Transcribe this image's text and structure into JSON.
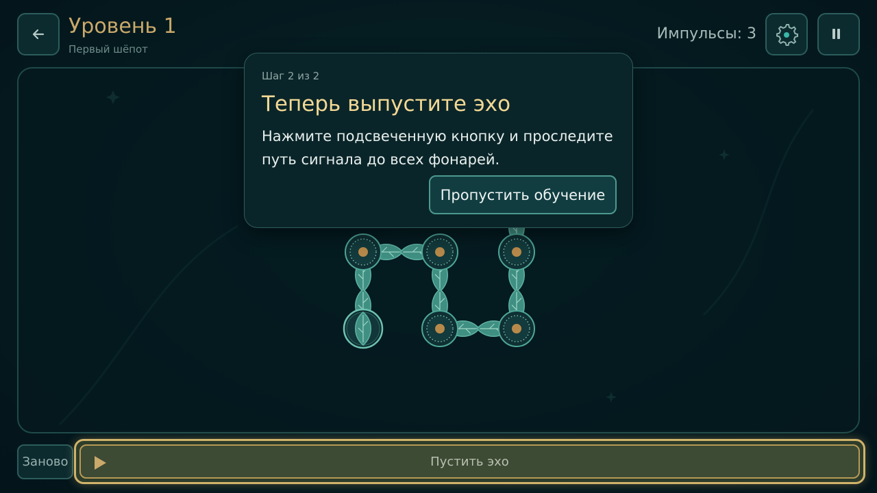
{
  "header": {
    "back_icon": "arrow-left-icon",
    "level_title": "Уровень 1",
    "level_subtitle": "Первый шёпот",
    "impulses_text": "Импульсы: 3",
    "settings_icon": "gear-icon",
    "pause_icon": "pause-icon"
  },
  "tutorial": {
    "step": "Шаг 2 из 2",
    "title": "Теперь выпустите эхо",
    "body": "Нажмите подсвеченную кнопку и проследите путь сигнала до всех фонарей.",
    "skip_label": "Пропустить обучение"
  },
  "board": {
    "nodes": [
      {
        "id": "n1",
        "kind": "lantern",
        "row": 0,
        "col": 0
      },
      {
        "id": "n2",
        "kind": "lantern",
        "row": 0,
        "col": 1
      },
      {
        "id": "n3",
        "kind": "lantern",
        "row": 0,
        "col": 2
      },
      {
        "id": "n4",
        "kind": "source",
        "row": 1,
        "col": 0
      },
      {
        "id": "n5",
        "kind": "lantern",
        "row": 1,
        "col": 1
      },
      {
        "id": "n6",
        "kind": "lantern",
        "row": 1,
        "col": 2
      }
    ],
    "links": [
      [
        "n1",
        "n2"
      ],
      [
        "n1",
        "n4"
      ],
      [
        "n2",
        "n5"
      ],
      [
        "n5",
        "n6"
      ],
      [
        "n3",
        "n6"
      ]
    ]
  },
  "footer": {
    "restart_label": "Заново",
    "play_icon": "play-icon",
    "play_label": "Пустить эхо"
  },
  "colors": {
    "accent_gold": "#c9a96a",
    "tutorial_title": "#f2d894",
    "node_teal": "#3f8f82",
    "node_core": "#b88a4a"
  }
}
